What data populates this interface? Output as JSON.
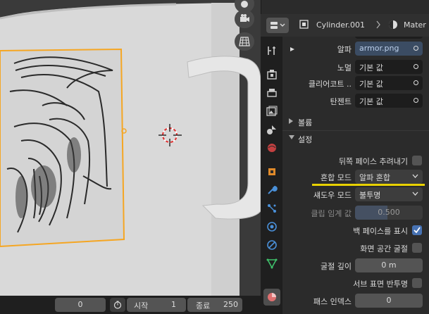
{
  "header": {
    "object_name": "Cylinder.001",
    "material_partial": "Mater"
  },
  "properties": {
    "alpha": {
      "label": "알파",
      "value": "armor.png"
    },
    "normal": {
      "label": "노멀",
      "value": "기본 값"
    },
    "clearcoat": {
      "label": "클리어코트 ..",
      "value": "기본 값"
    },
    "tangent": {
      "label": "탄젠트",
      "value": "기본 값"
    },
    "section_volume": "볼륨",
    "section_settings": "설정",
    "backface_culling": {
      "label": "뒤쪽 페이스 추려내기"
    },
    "blend_mode": {
      "label": "혼합 모드",
      "value": "알파 혼합"
    },
    "shadow_mode": {
      "label": "섀도우 모드",
      "value": "불투명"
    },
    "clip_threshold": {
      "label": "클립 임계 값",
      "value": "0.500"
    },
    "show_backface": {
      "label": "백 페이스를 표시"
    },
    "screen_space_refraction": {
      "label": "화면 공간 굴절"
    },
    "refraction_depth": {
      "label": "굴절 깊이",
      "value": "0 m"
    },
    "subsurface_translucency": {
      "label": "서브 표면 반투명"
    },
    "pass_index": {
      "label": "패스 인덱스",
      "value": "0"
    }
  },
  "timeline": {
    "current_frame": "0",
    "start_label": "시작",
    "start_value": "1",
    "end_label": "종료",
    "end_value": "250"
  },
  "colors": {
    "accent_blue": "#4772b3",
    "highlight_yellow": "#e8d100",
    "selection_orange": "#f5a623"
  }
}
